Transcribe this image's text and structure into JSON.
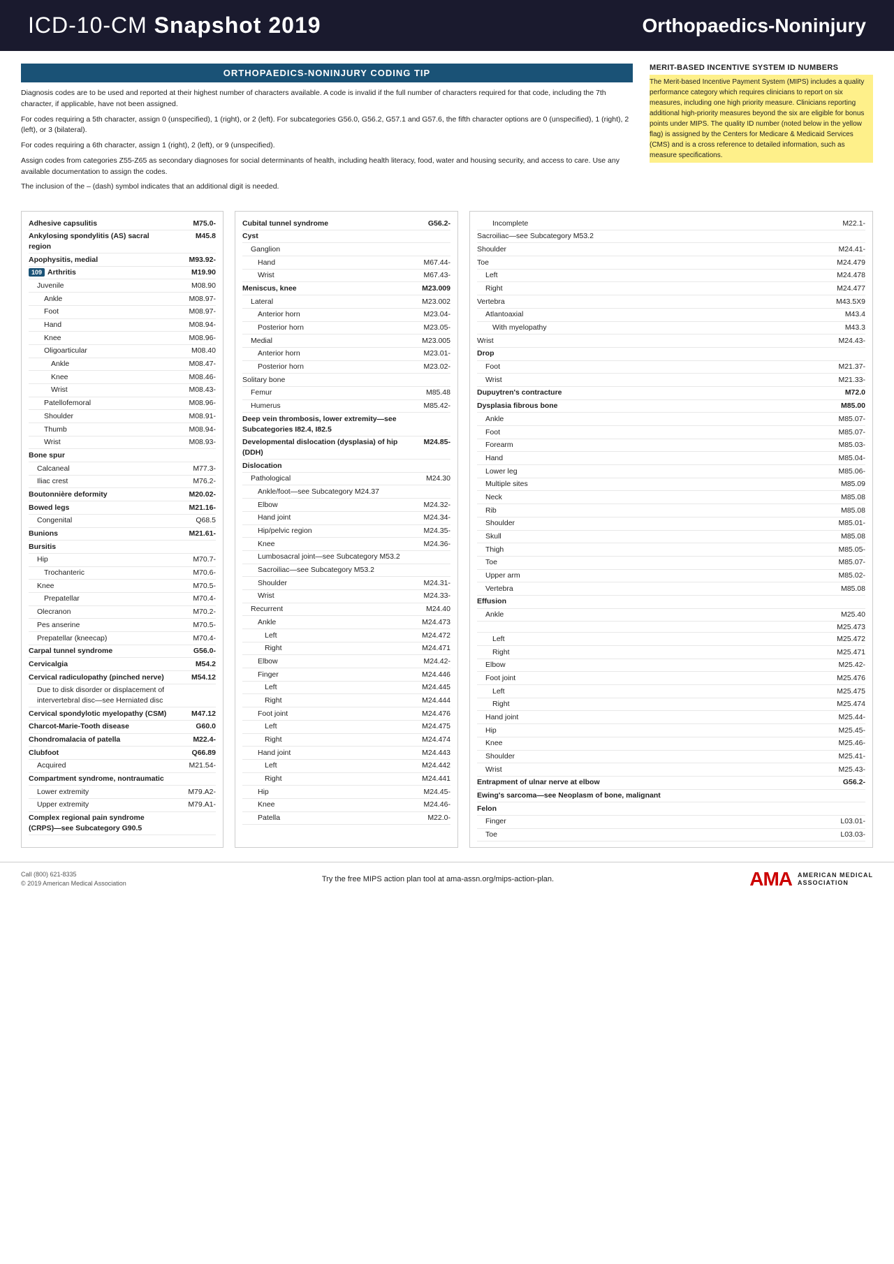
{
  "header": {
    "title_light": "ICD-10-CM ",
    "title_bold": "Snapshot 2019",
    "subtitle": "Orthopaedics-Noninjury"
  },
  "coding_tip": {
    "header": "ORTHOPAEDICS-NONINJURY CODING TIP",
    "paragraphs": [
      "Diagnosis codes are to be used and reported at their highest number of characters available. A code is invalid if the full number of characters required for that code, including the 7th character, if applicable, have not been assigned.",
      "For codes requiring a 5th character, assign 0 (unspecified), 1 (right), or 2 (left). For subcategories G56.0, G56.2, G57.1 and G57.6, the fifth character options are 0 (unspecified), 1 (right), 2 (left), or 3 (bilateral).",
      "For codes requiring a 6th character, assign 1 (right), 2 (left), or 9 (unspecified).",
      "Assign codes from categories Z55-Z65 as secondary diagnoses for social determinants of health, including health literacy, food, water and housing security, and access to care. Use any available documentation to assign the codes.",
      "The inclusion of the – (dash) symbol indicates that an additional digit is needed."
    ]
  },
  "merit_box": {
    "header": "MERIT-BASED INCENTIVE SYSTEM ID NUMBERS",
    "text": "The Merit-based Incentive Payment System (MIPS) includes a quality performance category which requires clinicians to report on six measures, including one high priority measure. Clinicians reporting additional high-priority measures beyond the six are eligible for bonus points under MIPS. The quality ID number (noted below in the yellow flag) is assigned by the Centers for Medicare & Medicaid Services (CMS) and is a cross reference to detailed information, such as measure specifications."
  },
  "left_col": {
    "entries": [
      {
        "label": "Adhesive capsulitis",
        "code": "M75.0-",
        "bold": true,
        "indent": 0
      },
      {
        "label": "Ankylosing spondylitis (AS) sacral region",
        "code": "M45.8",
        "bold": true,
        "indent": 0
      },
      {
        "label": "Apophysitis, medial",
        "code": "M93.92-",
        "bold": true,
        "indent": 0
      },
      {
        "label": "Arthritis",
        "code": "M19.90",
        "bold": true,
        "indent": 0,
        "badge": "109"
      },
      {
        "label": "Juvenile",
        "code": "M08.90",
        "bold": false,
        "indent": 1
      },
      {
        "label": "Ankle",
        "code": "M08.97-",
        "bold": false,
        "indent": 2
      },
      {
        "label": "Foot",
        "code": "M08.97-",
        "bold": false,
        "indent": 2
      },
      {
        "label": "Hand",
        "code": "M08.94-",
        "bold": false,
        "indent": 2
      },
      {
        "label": "Knee",
        "code": "M08.96-",
        "bold": false,
        "indent": 2
      },
      {
        "label": "Oligoarticular",
        "code": "M08.40",
        "bold": false,
        "indent": 2
      },
      {
        "label": "Ankle",
        "code": "M08.47-",
        "bold": false,
        "indent": 3
      },
      {
        "label": "Knee",
        "code": "M08.46-",
        "bold": false,
        "indent": 3
      },
      {
        "label": "Wrist",
        "code": "M08.43-",
        "bold": false,
        "indent": 3
      },
      {
        "label": "Patellofemoral",
        "code": "M08.96-",
        "bold": false,
        "indent": 2
      },
      {
        "label": "Shoulder",
        "code": "M08.91-",
        "bold": false,
        "indent": 2
      },
      {
        "label": "Thumb",
        "code": "M08.94-",
        "bold": false,
        "indent": 2
      },
      {
        "label": "Wrist",
        "code": "M08.93-",
        "bold": false,
        "indent": 2
      },
      {
        "label": "Bone spur",
        "code": "",
        "bold": true,
        "indent": 0
      },
      {
        "label": "Calcaneal",
        "code": "M77.3-",
        "bold": false,
        "indent": 1
      },
      {
        "label": "Iliac crest",
        "code": "M76.2-",
        "bold": false,
        "indent": 1
      },
      {
        "label": "Boutonnière deformity",
        "code": "M20.02-",
        "bold": true,
        "indent": 0
      },
      {
        "label": "Bowed legs",
        "code": "M21.16-",
        "bold": true,
        "indent": 0
      },
      {
        "label": "Congenital",
        "code": "Q68.5",
        "bold": false,
        "indent": 1
      },
      {
        "label": "Bunions",
        "code": "M21.61-",
        "bold": true,
        "indent": 0
      },
      {
        "label": "Bursitis",
        "code": "",
        "bold": true,
        "indent": 0
      },
      {
        "label": "Hip",
        "code": "M70.7-",
        "bold": false,
        "indent": 1
      },
      {
        "label": "Trochanteric",
        "code": "M70.6-",
        "bold": false,
        "indent": 2
      },
      {
        "label": "Knee",
        "code": "M70.5-",
        "bold": false,
        "indent": 1
      },
      {
        "label": "Prepatellar",
        "code": "M70.4-",
        "bold": false,
        "indent": 2
      },
      {
        "label": "Olecranon",
        "code": "M70.2-",
        "bold": false,
        "indent": 1
      },
      {
        "label": "Pes anserine",
        "code": "M70.5-",
        "bold": false,
        "indent": 1
      },
      {
        "label": "Prepatellar (kneecap)",
        "code": "M70.4-",
        "bold": false,
        "indent": 1
      },
      {
        "label": "Carpal tunnel syndrome",
        "code": "G56.0-",
        "bold": true,
        "indent": 0
      },
      {
        "label": "Cervicalgia",
        "code": "M54.2",
        "bold": true,
        "indent": 0
      },
      {
        "label": "Cervical radiculopathy (pinched nerve)",
        "code": "M54.12",
        "bold": true,
        "indent": 0
      },
      {
        "label": "Due to disk disorder or displacement of intervertebral disc—see Herniated disc",
        "code": "",
        "bold": false,
        "indent": 1
      },
      {
        "label": "Cervical spondylotic myelopathy (CSM)",
        "code": "M47.12",
        "bold": true,
        "indent": 0
      },
      {
        "label": "Charcot-Marie-Tooth disease",
        "code": "G60.0",
        "bold": true,
        "indent": 0
      },
      {
        "label": "Chondromalacia of patella",
        "code": "M22.4-",
        "bold": true,
        "indent": 0
      },
      {
        "label": "Clubfoot",
        "code": "Q66.89",
        "bold": true,
        "indent": 0
      },
      {
        "label": "Acquired",
        "code": "M21.54-",
        "bold": false,
        "indent": 1
      },
      {
        "label": "Compartment syndrome, nontraumatic",
        "code": "",
        "bold": true,
        "indent": 0
      },
      {
        "label": "Lower extremity",
        "code": "M79.A2-",
        "bold": false,
        "indent": 1
      },
      {
        "label": "Upper extremity",
        "code": "M79.A1-",
        "bold": false,
        "indent": 1
      },
      {
        "label": "Complex regional pain syndrome (CRPS)—see Subcategory G90.5",
        "code": "",
        "bold": true,
        "indent": 0
      }
    ]
  },
  "mid_col": {
    "entries": [
      {
        "label": "Cubital tunnel syndrome",
        "code": "G56.2-",
        "bold": true,
        "indent": 0
      },
      {
        "label": "Cyst",
        "code": "",
        "bold": true,
        "indent": 0
      },
      {
        "label": "Ganglion",
        "code": "",
        "bold": false,
        "indent": 1
      },
      {
        "label": "Hand",
        "code": "M67.44-",
        "bold": false,
        "indent": 2
      },
      {
        "label": "Wrist",
        "code": "M67.43-",
        "bold": false,
        "indent": 2
      },
      {
        "label": "Meniscus, knee",
        "code": "M23.009",
        "bold": true,
        "indent": 0
      },
      {
        "label": "Lateral",
        "code": "M23.002",
        "bold": false,
        "indent": 1
      },
      {
        "label": "Anterior horn",
        "code": "M23.04-",
        "bold": false,
        "indent": 2
      },
      {
        "label": "Posterior horn",
        "code": "M23.05-",
        "bold": false,
        "indent": 2
      },
      {
        "label": "Medial",
        "code": "M23.005",
        "bold": false,
        "indent": 1
      },
      {
        "label": "Anterior horn",
        "code": "M23.01-",
        "bold": false,
        "indent": 2
      },
      {
        "label": "Posterior horn",
        "code": "M23.02-",
        "bold": false,
        "indent": 2
      },
      {
        "label": "Solitary bone",
        "code": "",
        "bold": false,
        "indent": 0
      },
      {
        "label": "Femur",
        "code": "M85.48",
        "bold": false,
        "indent": 1
      },
      {
        "label": "Humerus",
        "code": "M85.42-",
        "bold": false,
        "indent": 1
      },
      {
        "label": "Deep vein thrombosis, lower extremity—see Subcategories I82.4, I82.5",
        "code": "",
        "bold": true,
        "indent": 0
      },
      {
        "label": "Developmental dislocation (dysplasia) of hip (DDH)",
        "code": "M24.85-",
        "bold": true,
        "indent": 0
      },
      {
        "label": "Dislocation",
        "code": "",
        "bold": true,
        "indent": 0
      },
      {
        "label": "Pathological",
        "code": "M24.30",
        "bold": false,
        "indent": 1
      },
      {
        "label": "Ankle/foot—see Subcategory M24.37",
        "code": "",
        "bold": false,
        "indent": 2
      },
      {
        "label": "Elbow",
        "code": "M24.32-",
        "bold": false,
        "indent": 2
      },
      {
        "label": "Hand joint",
        "code": "M24.34-",
        "bold": false,
        "indent": 2
      },
      {
        "label": "Hip/pelvic region",
        "code": "M24.35-",
        "bold": false,
        "indent": 2
      },
      {
        "label": "Knee",
        "code": "M24.36-",
        "bold": false,
        "indent": 2
      },
      {
        "label": "Lumbosacral joint—see Subcategory M53.2",
        "code": "",
        "bold": false,
        "indent": 2
      },
      {
        "label": "Sacroiliac—see Subcategory M53.2",
        "code": "",
        "bold": false,
        "indent": 2
      },
      {
        "label": "Shoulder",
        "code": "M24.31-",
        "bold": false,
        "indent": 2
      },
      {
        "label": "Wrist",
        "code": "M24.33-",
        "bold": false,
        "indent": 2
      },
      {
        "label": "Recurrent",
        "code": "M24.40",
        "bold": false,
        "indent": 1
      },
      {
        "label": "Ankle",
        "code": "M24.473",
        "bold": false,
        "indent": 2
      },
      {
        "label": "Left",
        "code": "M24.472",
        "bold": false,
        "indent": 3
      },
      {
        "label": "Right",
        "code": "M24.471",
        "bold": false,
        "indent": 3
      },
      {
        "label": "Elbow",
        "code": "M24.42-",
        "bold": false,
        "indent": 2
      },
      {
        "label": "Finger",
        "code": "M24.446",
        "bold": false,
        "indent": 2
      },
      {
        "label": "Left",
        "code": "M24.445",
        "bold": false,
        "indent": 3
      },
      {
        "label": "Right",
        "code": "M24.444",
        "bold": false,
        "indent": 3
      },
      {
        "label": "Foot joint",
        "code": "M24.476",
        "bold": false,
        "indent": 2
      },
      {
        "label": "Left",
        "code": "M24.475",
        "bold": false,
        "indent": 3
      },
      {
        "label": "Right",
        "code": "M24.474",
        "bold": false,
        "indent": 3
      },
      {
        "label": "Hand joint",
        "code": "M24.443",
        "bold": false,
        "indent": 2
      },
      {
        "label": "Left",
        "code": "M24.442",
        "bold": false,
        "indent": 3
      },
      {
        "label": "Right",
        "code": "M24.441",
        "bold": false,
        "indent": 3
      },
      {
        "label": "Hip",
        "code": "M24.45-",
        "bold": false,
        "indent": 2
      },
      {
        "label": "Knee",
        "code": "M24.46-",
        "bold": false,
        "indent": 2
      },
      {
        "label": "Patella",
        "code": "M22.0-",
        "bold": false,
        "indent": 2
      }
    ]
  },
  "right_col": {
    "entries": [
      {
        "label": "Incomplete",
        "code": "M22.1-",
        "bold": false,
        "indent": 2
      },
      {
        "label": "Sacroiliac—see Subcategory M53.2",
        "code": "",
        "bold": false,
        "indent": 0
      },
      {
        "label": "Shoulder",
        "code": "M24.41-",
        "bold": false,
        "indent": 0
      },
      {
        "label": "Toe",
        "code": "M24.479",
        "bold": false,
        "indent": 0
      },
      {
        "label": "Left",
        "code": "M24.478",
        "bold": false,
        "indent": 1
      },
      {
        "label": "Right",
        "code": "M24.477",
        "bold": false,
        "indent": 1
      },
      {
        "label": "Vertebra",
        "code": "M43.5X9",
        "bold": false,
        "indent": 0
      },
      {
        "label": "Atlantoaxial",
        "code": "M43.4",
        "bold": false,
        "indent": 1
      },
      {
        "label": "With myelopathy",
        "code": "M43.3",
        "bold": false,
        "indent": 2
      },
      {
        "label": "Wrist",
        "code": "M24.43-",
        "bold": false,
        "indent": 0
      },
      {
        "label": "Drop",
        "code": "",
        "bold": true,
        "indent": 0
      },
      {
        "label": "Foot",
        "code": "M21.37-",
        "bold": false,
        "indent": 1
      },
      {
        "label": "Wrist",
        "code": "M21.33-",
        "bold": false,
        "indent": 1
      },
      {
        "label": "Dupuytren's contracture",
        "code": "M72.0",
        "bold": true,
        "indent": 0
      },
      {
        "label": "Dysplasia fibrous bone",
        "code": "M85.00",
        "bold": true,
        "indent": 0
      },
      {
        "label": "Ankle",
        "code": "M85.07-",
        "bold": false,
        "indent": 1
      },
      {
        "label": "Foot",
        "code": "M85.07-",
        "bold": false,
        "indent": 1
      },
      {
        "label": "Forearm",
        "code": "M85.03-",
        "bold": false,
        "indent": 1
      },
      {
        "label": "Hand",
        "code": "M85.04-",
        "bold": false,
        "indent": 1
      },
      {
        "label": "Lower leg",
        "code": "M85.06-",
        "bold": false,
        "indent": 1
      },
      {
        "label": "Multiple sites",
        "code": "M85.09",
        "bold": false,
        "indent": 1
      },
      {
        "label": "Neck",
        "code": "M85.08",
        "bold": false,
        "indent": 1
      },
      {
        "label": "Rib",
        "code": "M85.08",
        "bold": false,
        "indent": 1
      },
      {
        "label": "Shoulder",
        "code": "M85.01-",
        "bold": false,
        "indent": 1
      },
      {
        "label": "Skull",
        "code": "M85.08",
        "bold": false,
        "indent": 1
      },
      {
        "label": "Thigh",
        "code": "M85.05-",
        "bold": false,
        "indent": 1
      },
      {
        "label": "Toe",
        "code": "M85.07-",
        "bold": false,
        "indent": 1
      },
      {
        "label": "Upper arm",
        "code": "M85.02-",
        "bold": false,
        "indent": 1
      },
      {
        "label": "Vertebra",
        "code": "M85.08",
        "bold": false,
        "indent": 1
      },
      {
        "label": "Effusion",
        "code": "",
        "bold": true,
        "indent": 0
      },
      {
        "label": "Ankle",
        "code": "M25.40",
        "bold": false,
        "indent": 1
      },
      {
        "label": "",
        "code": "M25.473",
        "bold": false,
        "indent": 1
      },
      {
        "label": "Left",
        "code": "M25.472",
        "bold": false,
        "indent": 2
      },
      {
        "label": "Right",
        "code": "M25.471",
        "bold": false,
        "indent": 2
      },
      {
        "label": "Elbow",
        "code": "M25.42-",
        "bold": false,
        "indent": 1
      },
      {
        "label": "Foot joint",
        "code": "M25.476",
        "bold": false,
        "indent": 1
      },
      {
        "label": "Left",
        "code": "M25.475",
        "bold": false,
        "indent": 2
      },
      {
        "label": "Right",
        "code": "M25.474",
        "bold": false,
        "indent": 2
      },
      {
        "label": "Hand joint",
        "code": "M25.44-",
        "bold": false,
        "indent": 1
      },
      {
        "label": "Hip",
        "code": "M25.45-",
        "bold": false,
        "indent": 1
      },
      {
        "label": "Knee",
        "code": "M25.46-",
        "bold": false,
        "indent": 1
      },
      {
        "label": "Shoulder",
        "code": "M25.41-",
        "bold": false,
        "indent": 1
      },
      {
        "label": "Wrist",
        "code": "M25.43-",
        "bold": false,
        "indent": 1
      },
      {
        "label": "Entrapment of ulnar nerve at elbow",
        "code": "G56.2-",
        "bold": true,
        "indent": 0
      },
      {
        "label": "Ewing's sarcoma—see Neoplasm of bone, malignant",
        "code": "",
        "bold": true,
        "indent": 0
      },
      {
        "label": "Felon",
        "code": "",
        "bold": true,
        "indent": 0
      },
      {
        "label": "Finger",
        "code": "L03.01-",
        "bold": false,
        "indent": 1
      },
      {
        "label": "Toe",
        "code": "L03.03-",
        "bold": false,
        "indent": 1
      }
    ]
  },
  "footer": {
    "left_line1": "Call (800) 621-8335",
    "left_line2": "© 2019 American Medical Association",
    "center": "Try the free MIPS action plan tool at ama-assn.org/mips-action-plan.",
    "ama_text1": "AMERICAN MEDICAL",
    "ama_text2": "ASSOCIATION"
  }
}
